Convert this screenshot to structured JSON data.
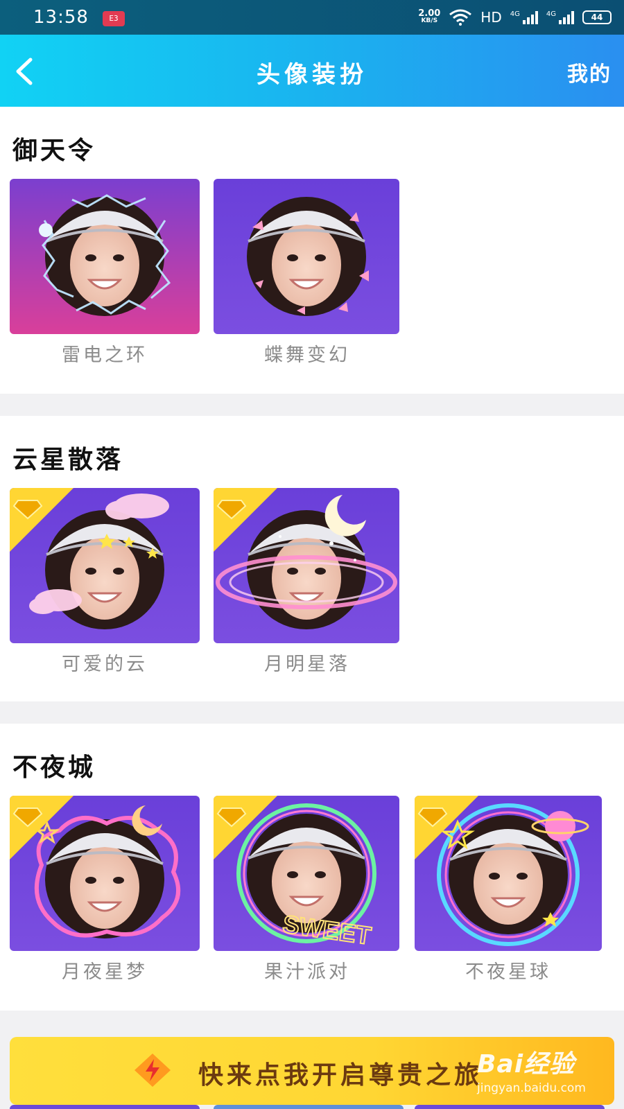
{
  "status_bar": {
    "time": "13:58",
    "rec_badge": "E3",
    "speed_value": "2.00",
    "speed_unit": "KB/S",
    "hd_label": "HD",
    "net1": "4G",
    "net2": "4G",
    "battery": "44"
  },
  "header": {
    "title": "头像装扮",
    "mine": "我的"
  },
  "sections": [
    {
      "title": "御天令",
      "items": [
        {
          "label": "雷电之环"
        },
        {
          "label": "蝶舞变幻"
        }
      ]
    },
    {
      "title": "云星散落",
      "items": [
        {
          "label": "可爱的云"
        },
        {
          "label": "月明星落"
        }
      ]
    },
    {
      "title": "不夜城",
      "items": [
        {
          "label": "月夜星梦"
        },
        {
          "label": "果汁派对"
        },
        {
          "label": "不夜星球"
        }
      ]
    }
  ],
  "sweet_text": "SWEET",
  "banner": {
    "text": "快来点我开启尊贵之旅"
  },
  "watermark": {
    "main": "Bai经验",
    "sub": "jingyan.baidu.com"
  },
  "colors": {
    "accent": "#1ab3ef",
    "card_purple": "#6b4ad8",
    "vip_gold": "#ffd633"
  },
  "icons": [
    "back-chevron-icon",
    "wifi-icon",
    "signal-icon",
    "battery-icon",
    "diamond-icon",
    "lightning-icon"
  ]
}
